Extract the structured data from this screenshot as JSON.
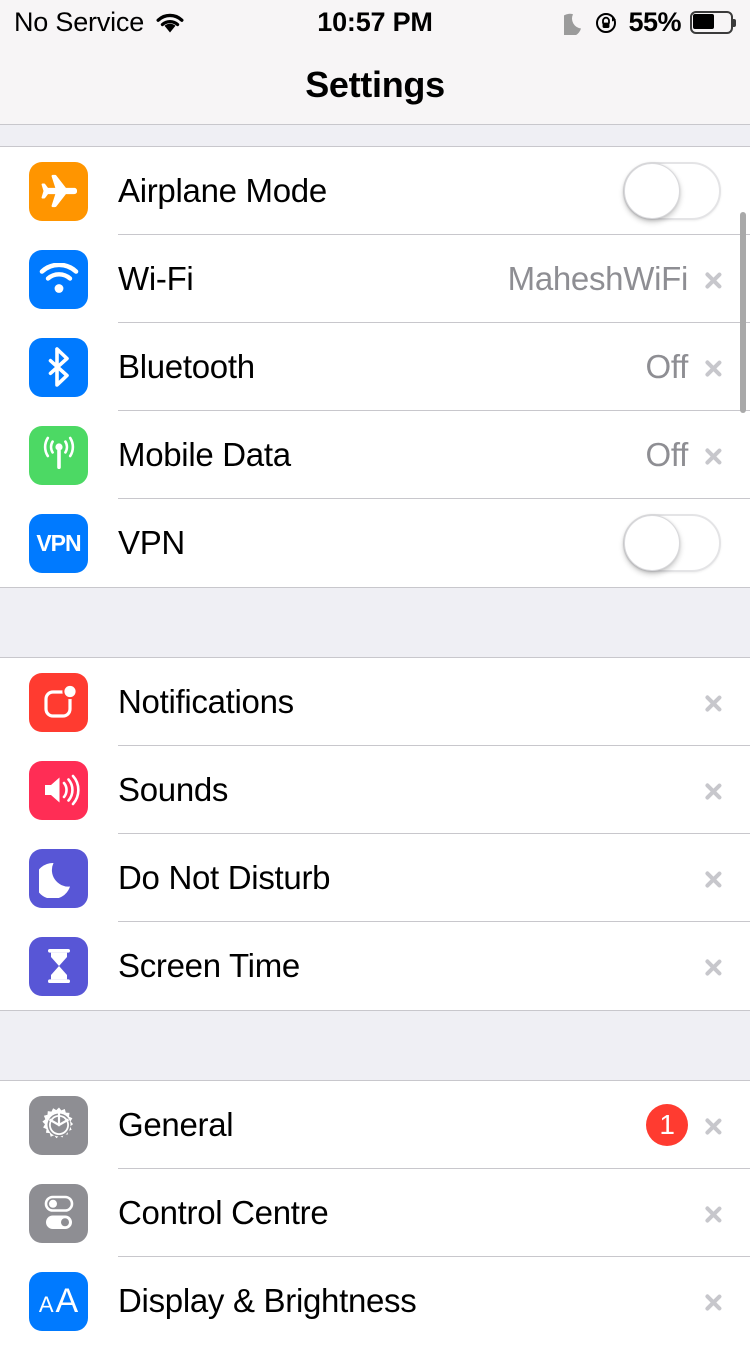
{
  "status_bar": {
    "carrier": "No Service",
    "wifi_icon": "wifi-icon",
    "time": "10:57 PM",
    "do_not_disturb_icon": "moon-icon",
    "rotation_lock_icon": "rotation-lock-icon",
    "battery_percent": "55%",
    "battery_icon": "battery-icon"
  },
  "nav": {
    "title": "Settings"
  },
  "colors": {
    "orange": "#FF9500",
    "blue": "#007AFF",
    "green": "#4CD964",
    "red": "#FF3B30",
    "pink": "#FF2D55",
    "indigo": "#5856D6",
    "gray": "#8E8E93",
    "badge_red": "#FF3B30",
    "value_gray": "#8E8E93",
    "group_bg": "#EFEFF4",
    "separator": "#C8C7CC"
  },
  "groups": [
    {
      "id": "connectivity",
      "rows": [
        {
          "label": "Airplane Mode",
          "icon": "airplane-icon",
          "accessory": "toggle",
          "toggle_on": false
        },
        {
          "label": "Wi-Fi",
          "icon": "wifi-icon",
          "accessory": "chevron",
          "value": "MaheshWiFi"
        },
        {
          "label": "Bluetooth",
          "icon": "bluetooth-icon",
          "accessory": "chevron",
          "value": "Off"
        },
        {
          "label": "Mobile Data",
          "icon": "cellular-icon",
          "accessory": "chevron",
          "value": "Off"
        },
        {
          "label": "VPN",
          "icon": "vpn-icon",
          "accessory": "toggle",
          "toggle_on": false,
          "icon_text": "VPN"
        }
      ]
    },
    {
      "id": "alerts",
      "rows": [
        {
          "label": "Notifications",
          "icon": "notifications-icon",
          "accessory": "chevron"
        },
        {
          "label": "Sounds",
          "icon": "sounds-icon",
          "accessory": "chevron"
        },
        {
          "label": "Do Not Disturb",
          "icon": "moon-icon",
          "accessory": "chevron"
        },
        {
          "label": "Screen Time",
          "icon": "hourglass-icon",
          "accessory": "chevron"
        }
      ]
    },
    {
      "id": "system",
      "rows": [
        {
          "label": "General",
          "icon": "gear-icon",
          "accessory": "chevron",
          "badge": "1"
        },
        {
          "label": "Control Centre",
          "icon": "control-centre-icon",
          "accessory": "chevron"
        },
        {
          "label": "Display & Brightness",
          "icon": "display-icon",
          "accessory": "chevron",
          "icon_text": "AA"
        }
      ]
    }
  ]
}
